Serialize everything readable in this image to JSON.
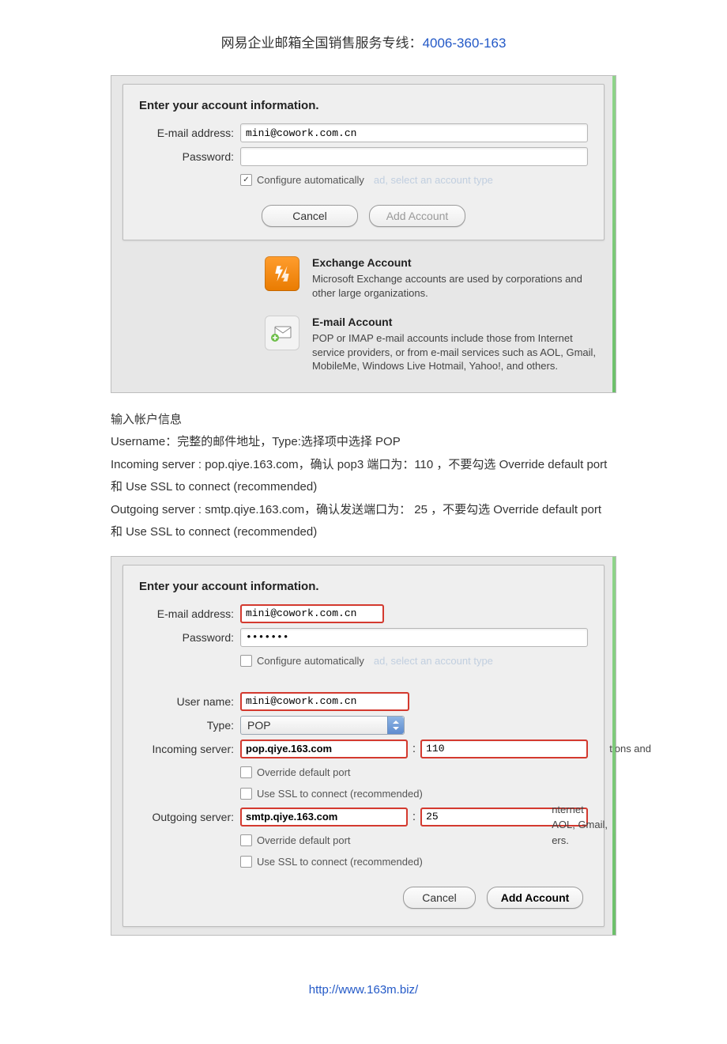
{
  "header": {
    "prefix": "网易企业邮箱全国销售服务专线：",
    "hotline": "4006-360-163"
  },
  "dialog1": {
    "title": "Enter your account information.",
    "email_label": "E-mail address:",
    "email_value": "mini@cowork.com.cn",
    "password_label": "Password:",
    "password_value": "",
    "auto_label": "Configure automatically",
    "auto_checked": true,
    "ghost_hint": "ad, select an account type",
    "cancel": "Cancel",
    "add": "Add Account",
    "tile_exchange_title": "Exchange Account",
    "tile_exchange_body": "Microsoft Exchange accounts are used by corporations and other large organizations.",
    "tile_email_title": "E-mail Account",
    "tile_email_body": "POP or IMAP e-mail accounts include those from Internet service providers, or from e-mail services such as AOL, Gmail, MobileMe, Windows Live Hotmail, Yahoo!, and others."
  },
  "instructions": {
    "l1": "输入帐户信息",
    "l2": "Username：完整的邮件地址，Type:选择项中选择 POP",
    "l3": "Incoming server : pop.qiye.163.com，确认 pop3 端口为：110 ，不要勾选 Override default port 和 Use SSL to connect (recommended)",
    "l4": "Outgoing server : smtp.qiye.163.com，确认发送端口为：  25 ，不要勾选 Override default port 和 Use SSL to connect (recommended)"
  },
  "dialog2": {
    "title": "Enter your account information.",
    "email_label": "E-mail address:",
    "email_value": "mini@cowork.com.cn",
    "password_label": "Password:",
    "password_value": "•••••••",
    "auto_label": "Configure automatically",
    "auto_checked": false,
    "ghost_hint": "ad, select an account type",
    "username_label": "User name:",
    "username_value": "mini@cowork.com.cn",
    "type_label": "Type:",
    "type_value": "POP",
    "incoming_label": "Incoming server:",
    "incoming_value": "pop.qiye.163.com",
    "incoming_port": "110",
    "outgoing_label": "Outgoing server:",
    "outgoing_value": "smtp.qiye.163.com",
    "outgoing_port": "25",
    "override_label": "Override default port",
    "ssl_label": "Use SSL to connect (recommended)",
    "bg_hint_in": "tions and",
    "bg_hint_out1": "nternet",
    "bg_hint_out2": "AOL, Gmail,",
    "bg_hint_out3": "ers.",
    "cancel": "Cancel",
    "add": "Add Account"
  },
  "footer": {
    "url": "http://www.163m.biz/"
  }
}
